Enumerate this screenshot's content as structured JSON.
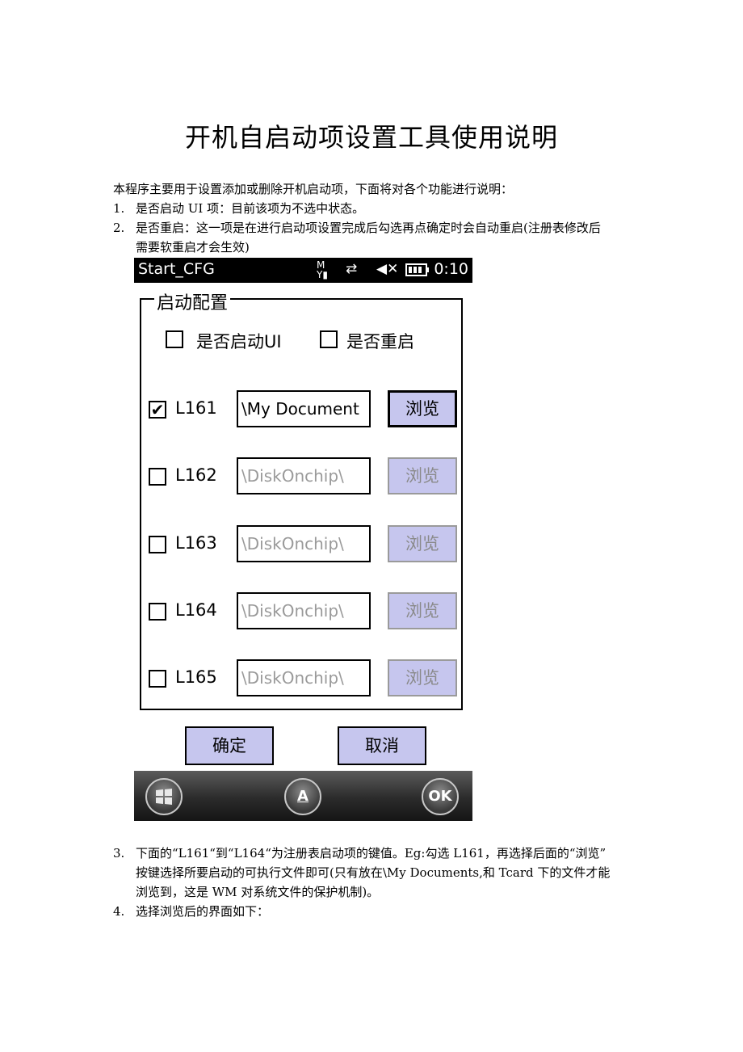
{
  "title": "开机自启动项设置工具使用说明",
  "intro": "本程序主要用于设置添加或删除开机启动项，下面将对各个功能进行说明：",
  "items_top": [
    {
      "num": "1.",
      "lines": [
        "是否启动 UI 项：目前该项为不选中状态。"
      ]
    },
    {
      "num": "2.",
      "lines": [
        "是否重启：这一项是在进行启动项设置完成后勾选再点确定时会自动重启(注册表修改后",
        "需要软重启才会生效)"
      ]
    }
  ],
  "screenshot": {
    "status": {
      "app": "Start_CFG",
      "time": "0:10"
    },
    "group_title": "启动配置",
    "top_options": [
      {
        "label": "是否启动UI",
        "checked": false
      },
      {
        "label": "是否重启",
        "checked": false
      }
    ],
    "rows": [
      {
        "label": "L161",
        "checked": true,
        "path": "\\My Document",
        "browse": "浏览",
        "enabled": true
      },
      {
        "label": "L162",
        "checked": false,
        "path": "\\DiskOnchip\\",
        "browse": "浏览",
        "enabled": false
      },
      {
        "label": "L163",
        "checked": false,
        "path": "\\DiskOnchip\\",
        "browse": "浏览",
        "enabled": false
      },
      {
        "label": "L164",
        "checked": false,
        "path": "\\DiskOnchip\\",
        "browse": "浏览",
        "enabled": false
      },
      {
        "label": "L165",
        "checked": false,
        "path": "\\DiskOnchip\\",
        "browse": "浏览",
        "enabled": false
      }
    ],
    "confirm": "确定",
    "cancel": "取消",
    "soft_ok": "OK",
    "soft_keyboard": "A"
  },
  "items_bottom": [
    {
      "num": "3.",
      "lines": [
        "下面的“L161“到“L164“为注册表启动项的键值。Eg:勾选 L161，再选择后面的“浏览”",
        "按键选择所要启动的可执行文件即可(只有放在\\My Documents,和 Tcard 下的文件才能",
        "浏览到，这是 WM 对系统文件的保护机制)。"
      ]
    },
    {
      "num": "4.",
      "lines": [
        "选择浏览后的界面如下："
      ]
    }
  ]
}
